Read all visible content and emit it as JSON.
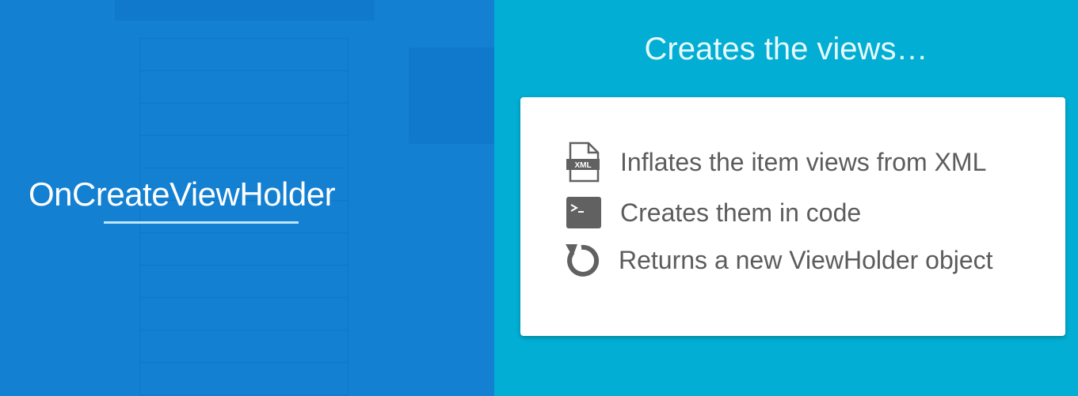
{
  "left": {
    "title": "OnCreateViewHolder",
    "background": "#1380d2"
  },
  "right": {
    "heading": "Creates the views…",
    "background": "#02aed3",
    "items": [
      {
        "icon": "xml-file-icon",
        "label": "Inflates the item views from XML",
        "icon_text": "XML"
      },
      {
        "icon": "terminal-icon",
        "label": "Creates them in code"
      },
      {
        "icon": "refresh-icon",
        "label": "Returns a new ViewHolder object"
      }
    ]
  }
}
